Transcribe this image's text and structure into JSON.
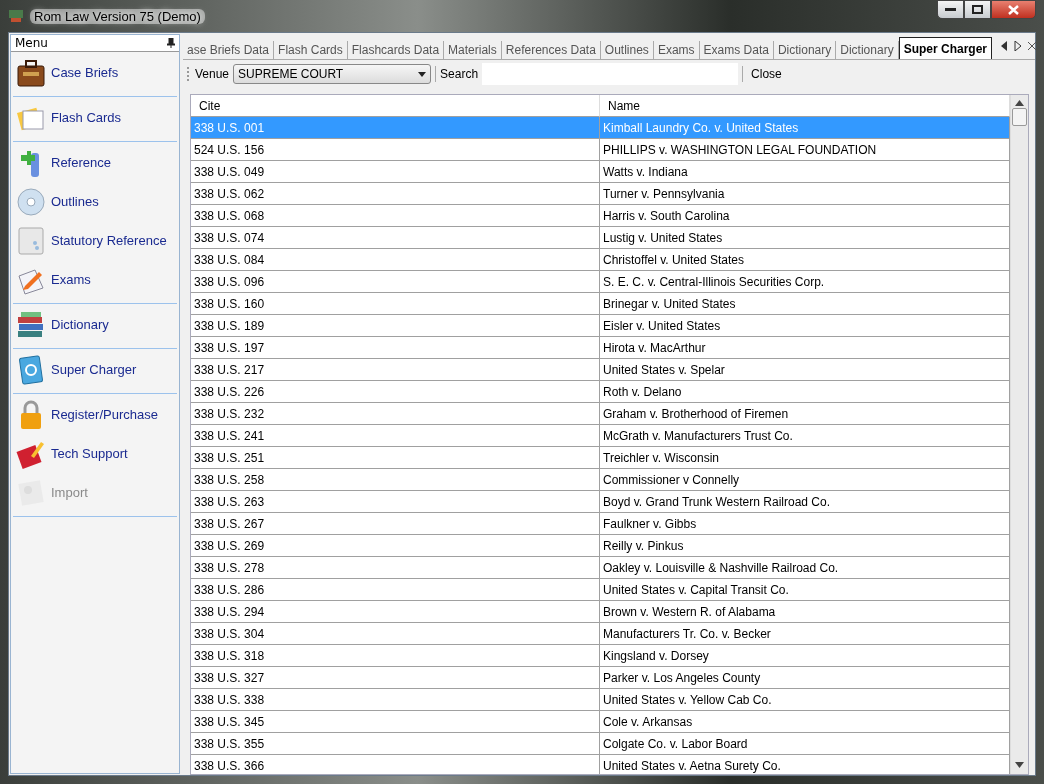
{
  "window": {
    "title": "Rom Law Version 75 (Demo)"
  },
  "sidebar": {
    "title": "Menu",
    "groups": [
      {
        "items": [
          {
            "label": "Case Briefs",
            "disabled": false
          }
        ]
      },
      {
        "items": [
          {
            "label": "Flash Cards",
            "disabled": false
          }
        ]
      },
      {
        "items": [
          {
            "label": "Reference",
            "disabled": false
          },
          {
            "label": "Outlines",
            "disabled": false
          },
          {
            "label": "Statutory Reference",
            "disabled": false
          },
          {
            "label": "Exams",
            "disabled": false
          }
        ]
      },
      {
        "items": [
          {
            "label": "Dictionary",
            "disabled": false
          }
        ]
      },
      {
        "items": [
          {
            "label": "Super Charger",
            "disabled": false
          }
        ]
      },
      {
        "items": [
          {
            "label": "Register/Purchase",
            "disabled": false
          },
          {
            "label": "Tech Support",
            "disabled": false
          },
          {
            "label": "Import",
            "disabled": true
          }
        ]
      }
    ]
  },
  "tabs": [
    {
      "label": "ase Briefs Data",
      "selected": false
    },
    {
      "label": "Flash Cards",
      "selected": false
    },
    {
      "label": "Flashcards Data",
      "selected": false
    },
    {
      "label": "Materials",
      "selected": false
    },
    {
      "label": "References Data",
      "selected": false
    },
    {
      "label": "Outlines",
      "selected": false
    },
    {
      "label": "Exams",
      "selected": false
    },
    {
      "label": "Exams Data",
      "selected": false
    },
    {
      "label": "Dictionary",
      "selected": false
    },
    {
      "label": "Dictionary",
      "selected": false
    },
    {
      "label": "Super Charger",
      "selected": true
    }
  ],
  "toolbar": {
    "venue_label": "Venue",
    "venue_value": "SUPREME COURT",
    "search_label": "Search",
    "close_label": "Close"
  },
  "table": {
    "columns": [
      "Cite",
      "Name"
    ],
    "rows": [
      {
        "cite": "338 U.S. 001",
        "name": "Kimball Laundry Co. v. United States",
        "selected": true
      },
      {
        "cite": "524 U.S. 156",
        "name": "PHILLIPS v. WASHINGTON LEGAL FOUNDATION",
        "selected": false
      },
      {
        "cite": "338 U.S. 049",
        "name": "Watts v. Indiana",
        "selected": false
      },
      {
        "cite": "338 U.S. 062",
        "name": "Turner v. Pennsylvania",
        "selected": false
      },
      {
        "cite": "338 U.S. 068",
        "name": "Harris v. South Carolina",
        "selected": false
      },
      {
        "cite": "338 U.S. 074",
        "name": "Lustig v. United States",
        "selected": false
      },
      {
        "cite": "338 U.S. 084",
        "name": "Christoffel v. United States",
        "selected": false
      },
      {
        "cite": "338 U.S. 096",
        "name": "S. E. C. v. Central-Illinois Securities Corp.",
        "selected": false
      },
      {
        "cite": "338 U.S. 160",
        "name": "Brinegar v. United States",
        "selected": false
      },
      {
        "cite": "338 U.S. 189",
        "name": "Eisler v. United States",
        "selected": false
      },
      {
        "cite": "338 U.S. 197",
        "name": "Hirota v. MacArthur",
        "selected": false
      },
      {
        "cite": "338 U.S. 217",
        "name": "United States v. Spelar",
        "selected": false
      },
      {
        "cite": "338 U.S. 226",
        "name": "Roth v. Delano",
        "selected": false
      },
      {
        "cite": "338 U.S. 232",
        "name": "Graham v. Brotherhood of Firemen",
        "selected": false
      },
      {
        "cite": "338 U.S. 241",
        "name": "McGrath v. Manufacturers Trust Co.",
        "selected": false
      },
      {
        "cite": "338 U.S. 251",
        "name": "Treichler v. Wisconsin",
        "selected": false
      },
      {
        "cite": "338 U.S. 258",
        "name": "Commissioner v Connelly",
        "selected": false
      },
      {
        "cite": "338 U.S. 263",
        "name": "Boyd v. Grand Trunk Western Railroad Co.",
        "selected": false
      },
      {
        "cite": "338 U.S. 267",
        "name": "Faulkner v. Gibbs",
        "selected": false
      },
      {
        "cite": "338 U.S. 269",
        "name": "Reilly v. Pinkus",
        "selected": false
      },
      {
        "cite": "338 U.S. 278",
        "name": "Oakley v. Louisville & Nashville Railroad Co.",
        "selected": false
      },
      {
        "cite": "338 U.S. 286",
        "name": "United States v. Capital Transit Co.",
        "selected": false
      },
      {
        "cite": "338 U.S. 294",
        "name": "Brown v. Western R. of Alabama",
        "selected": false
      },
      {
        "cite": "338 U.S. 304",
        "name": "Manufacturers Tr. Co. v. Becker",
        "selected": false
      },
      {
        "cite": "338 U.S. 318",
        "name": "Kingsland v. Dorsey",
        "selected": false
      },
      {
        "cite": "338 U.S. 327",
        "name": "Parker v. Los Angeles County",
        "selected": false
      },
      {
        "cite": "338 U.S. 338",
        "name": "United States v. Yellow Cab Co.",
        "selected": false
      },
      {
        "cite": "338 U.S. 345",
        "name": "Cole v. Arkansas",
        "selected": false
      },
      {
        "cite": "338 U.S. 355",
        "name": "Colgate Co. v. Labor Board",
        "selected": false
      },
      {
        "cite": "338 U.S. 366",
        "name": "United States v. Aetna Surety Co.",
        "selected": false
      }
    ]
  }
}
